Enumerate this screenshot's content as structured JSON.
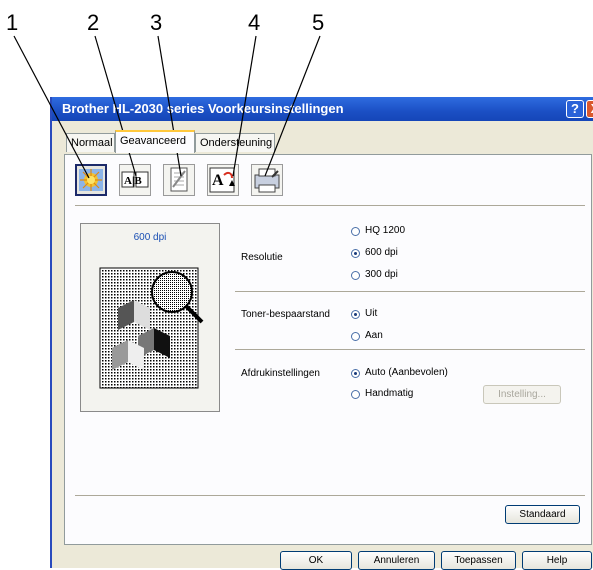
{
  "callouts": [
    "1",
    "2",
    "3",
    "4",
    "5"
  ],
  "window": {
    "title": "Brother HL-2030 series Voorkeursinstellingen",
    "help_label": "?",
    "close_label": "X"
  },
  "tabs": [
    "Normaal",
    "Geavanceerd",
    "Ondersteuning"
  ],
  "toolbar_icons": [
    "print-quality-icon",
    "duplex-icon",
    "watermark-icon",
    "page-setting-icon",
    "device-options-icon"
  ],
  "toolbar_icon_2_label": "A|B",
  "toolbar_icon_4_label": "A",
  "preview": {
    "label": "600 dpi"
  },
  "resolution": {
    "label": "Resolutie",
    "options": [
      "HQ 1200",
      "600 dpi",
      "300 dpi"
    ],
    "selected": "600 dpi"
  },
  "toner": {
    "label": "Toner-bespaarstand",
    "options": [
      "Uit",
      "Aan"
    ],
    "selected": "Uit"
  },
  "print_settings": {
    "label": "Afdrukinstellingen",
    "options": [
      "Auto (Aanbevolen)",
      "Handmatig"
    ],
    "selected": "Auto (Aanbevolen)",
    "settings_button": "Instelling..."
  },
  "default_button": "Standaard",
  "footer": {
    "ok": "OK",
    "cancel": "Annuleren",
    "apply": "Toepassen",
    "help": "Help"
  }
}
